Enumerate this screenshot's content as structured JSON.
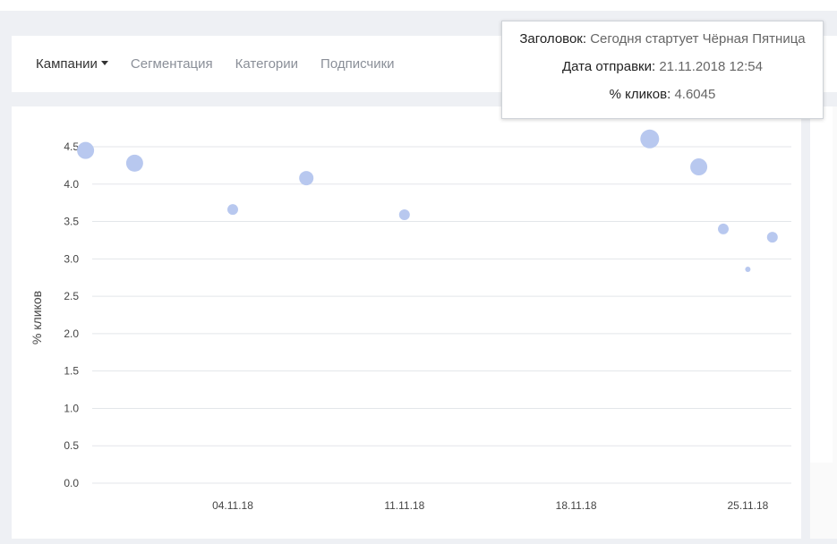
{
  "nav": {
    "items": [
      {
        "label": "Кампании",
        "active": true
      },
      {
        "label": "Сегментация",
        "active": false
      },
      {
        "label": "Категории",
        "active": false
      },
      {
        "label": "Подписчики",
        "active": false
      }
    ]
  },
  "tooltip": {
    "title_key": "Заголовок",
    "title_value": "Сегодня стартует Чёрная Пятница",
    "date_key": "Дата отправки",
    "date_value": "21.11.2018 12:54",
    "metric_key": "% кликов",
    "metric_value": "4.6045"
  },
  "chart_data": {
    "type": "scatter",
    "ylabel": "% кликов",
    "ylim": [
      0,
      4.5
    ],
    "yticks": [
      "0.0",
      "0.5",
      "1.0",
      "1.5",
      "2.0",
      "2.5",
      "3.0",
      "3.5",
      "4.0",
      "4.5"
    ],
    "xticks": [
      "04.11.18",
      "11.11.18",
      "18.11.18",
      "25.11.18"
    ],
    "point_color": "#b8c8ef",
    "points": [
      {
        "x": "29.10.18",
        "y": 4.45,
        "size": "large"
      },
      {
        "x": "31.10.18",
        "y": 4.28,
        "size": "large"
      },
      {
        "x": "04.11.18",
        "y": 3.66,
        "size": "small"
      },
      {
        "x": "07.11.18",
        "y": 4.08,
        "size": "medium"
      },
      {
        "x": "11.11.18",
        "y": 3.59,
        "size": "small"
      },
      {
        "x": "21.11.18",
        "y": 4.6045,
        "size": "xlarge"
      },
      {
        "x": "23.11.18",
        "y": 4.23,
        "size": "large"
      },
      {
        "x": "24.11.18",
        "y": 3.4,
        "size": "small"
      },
      {
        "x": "25.11.18",
        "y": 2.86,
        "size": "tiny"
      },
      {
        "x": "26.11.18",
        "y": 3.29,
        "size": "small"
      }
    ]
  }
}
